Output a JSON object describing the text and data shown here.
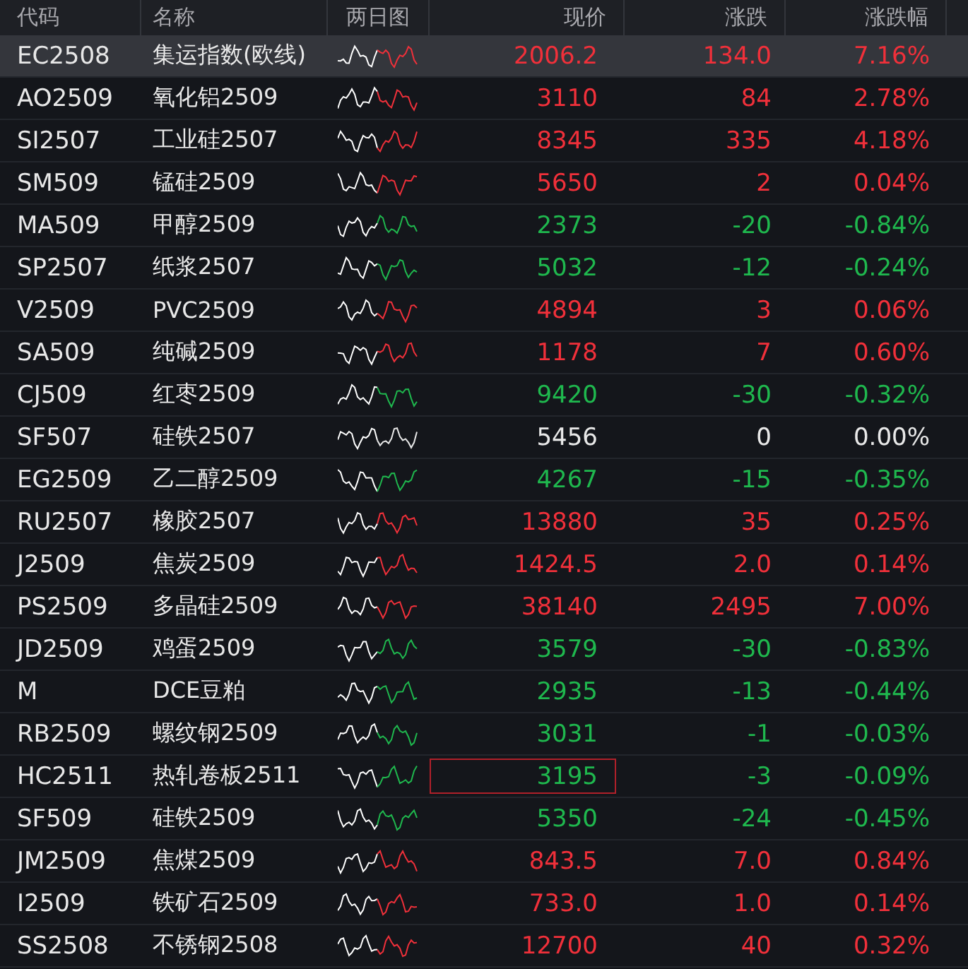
{
  "columns": [
    "代码",
    "名称",
    "两日图",
    "现价",
    "涨跌",
    "涨跌幅"
  ],
  "rows": [
    {
      "code": "EC2508",
      "name": "集运指数(欧线)",
      "price": "2006.2",
      "change": "134.0",
      "pct": "7.16%",
      "color": "#f0303a",
      "selected": true,
      "price_outlined": false
    },
    {
      "code": "AO2509",
      "name": "氧化铝2509",
      "price": "3110",
      "change": "84",
      "pct": "2.78%",
      "color": "#f0303a",
      "selected": false,
      "price_outlined": false
    },
    {
      "code": "SI2507",
      "name": "工业硅2507",
      "price": "8345",
      "change": "335",
      "pct": "4.18%",
      "color": "#f0303a",
      "selected": false,
      "price_outlined": false
    },
    {
      "code": "SM509",
      "name": "锰硅2509",
      "price": "5650",
      "change": "2",
      "pct": "0.04%",
      "color": "#f0303a",
      "selected": false,
      "price_outlined": false
    },
    {
      "code": "MA509",
      "name": "甲醇2509",
      "price": "2373",
      "change": "-20",
      "pct": "-0.84%",
      "color": "#1fb84e",
      "selected": false,
      "price_outlined": false
    },
    {
      "code": "SP2507",
      "name": "纸浆2507",
      "price": "5032",
      "change": "-12",
      "pct": "-0.24%",
      "color": "#1fb84e",
      "selected": false,
      "price_outlined": false
    },
    {
      "code": "V2509",
      "name": "PVC2509",
      "price": "4894",
      "change": "3",
      "pct": "0.06%",
      "color": "#f0303a",
      "selected": false,
      "price_outlined": false
    },
    {
      "code": "SA509",
      "name": "纯碱2509",
      "price": "1178",
      "change": "7",
      "pct": "0.60%",
      "color": "#f0303a",
      "selected": false,
      "price_outlined": false
    },
    {
      "code": "CJ509",
      "name": "红枣2509",
      "price": "9420",
      "change": "-30",
      "pct": "-0.32%",
      "color": "#1fb84e",
      "selected": false,
      "price_outlined": false
    },
    {
      "code": "SF507",
      "name": "硅铁2507",
      "price": "5456",
      "change": "0",
      "pct": "0.00%",
      "color": "#e8e8e8",
      "selected": false,
      "price_outlined": false
    },
    {
      "code": "EG2509",
      "name": "乙二醇2509",
      "price": "4267",
      "change": "-15",
      "pct": "-0.35%",
      "color": "#1fb84e",
      "selected": false,
      "price_outlined": false
    },
    {
      "code": "RU2507",
      "name": "橡胶2507",
      "price": "13880",
      "change": "35",
      "pct": "0.25%",
      "color": "#f0303a",
      "selected": false,
      "price_outlined": false
    },
    {
      "code": "J2509",
      "name": "焦炭2509",
      "price": "1424.5",
      "change": "2.0",
      "pct": "0.14%",
      "color": "#f0303a",
      "selected": false,
      "price_outlined": false
    },
    {
      "code": "PS2509",
      "name": "多晶硅2509",
      "price": "38140",
      "change": "2495",
      "pct": "7.00%",
      "color": "#f0303a",
      "selected": false,
      "price_outlined": false
    },
    {
      "code": "JD2509",
      "name": "鸡蛋2509",
      "price": "3579",
      "change": "-30",
      "pct": "-0.83%",
      "color": "#1fb84e",
      "selected": false,
      "price_outlined": false
    },
    {
      "code": "M",
      "name": "DCE豆粕",
      "price": "2935",
      "change": "-13",
      "pct": "-0.44%",
      "color": "#1fb84e",
      "selected": false,
      "price_outlined": false
    },
    {
      "code": "RB2509",
      "name": "螺纹钢2509",
      "price": "3031",
      "change": "-1",
      "pct": "-0.03%",
      "color": "#1fb84e",
      "selected": false,
      "price_outlined": false
    },
    {
      "code": "HC2511",
      "name": "热轧卷板2511",
      "price": "3195",
      "change": "-3",
      "pct": "-0.09%",
      "color": "#1fb84e",
      "selected": false,
      "price_outlined": true
    },
    {
      "code": "SF509",
      "name": "硅铁2509",
      "price": "5350",
      "change": "-24",
      "pct": "-0.45%",
      "color": "#1fb84e",
      "selected": false,
      "price_outlined": false
    },
    {
      "code": "JM2509",
      "name": "焦煤2509",
      "price": "843.5",
      "change": "7.0",
      "pct": "0.84%",
      "color": "#f0303a",
      "selected": false,
      "price_outlined": false
    },
    {
      "code": "I2509",
      "name": "铁矿石2509",
      "price": "733.0",
      "change": "1.0",
      "pct": "0.14%",
      "color": "#f0303a",
      "selected": false,
      "price_outlined": false
    },
    {
      "code": "SS2508",
      "name": "不锈钢2508",
      "price": "12700",
      "change": "40",
      "pct": "0.32%",
      "color": "#f0303a",
      "selected": false,
      "price_outlined": false
    }
  ]
}
